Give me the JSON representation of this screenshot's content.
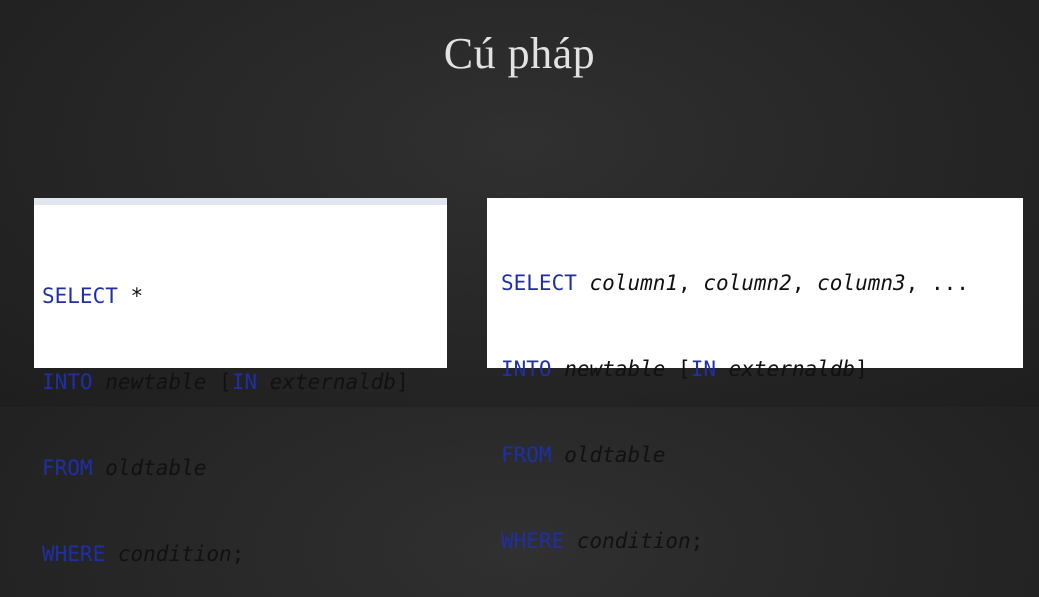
{
  "slide": {
    "title": "Cú pháp"
  },
  "code_left": {
    "lines": [
      {
        "kw": "SELECT",
        "sep": " ",
        "rest": "*"
      },
      {
        "kw": "INTO",
        "sep": " ",
        "ident": "newtable",
        "sep2": " [",
        "kw2": "IN",
        "sep3": " ",
        "ident2": "externaldb",
        "tail": "]"
      },
      {
        "kw": "FROM",
        "sep": " ",
        "ident": "oldtable"
      },
      {
        "kw": "WHERE",
        "sep": " ",
        "ident": "condition",
        "tail": ";"
      }
    ]
  },
  "code_right": {
    "lines": [
      {
        "kw": "SELECT",
        "sep": " ",
        "ident": "column1",
        "sep2": ", ",
        "ident2": "column2",
        "sep3": ", ",
        "ident3": "column3",
        "tail": ", ..."
      },
      {
        "kw": "INTO",
        "sep": " ",
        "ident": "newtable",
        "sep2": " [",
        "kw2": "IN",
        "sep3": " ",
        "ident2": "externaldb",
        "tail": "]"
      },
      {
        "kw": "FROM",
        "sep": " ",
        "ident": "oldtable"
      },
      {
        "kw": "WHERE",
        "sep": " ",
        "ident": "condition",
        "tail": ";"
      }
    ]
  }
}
